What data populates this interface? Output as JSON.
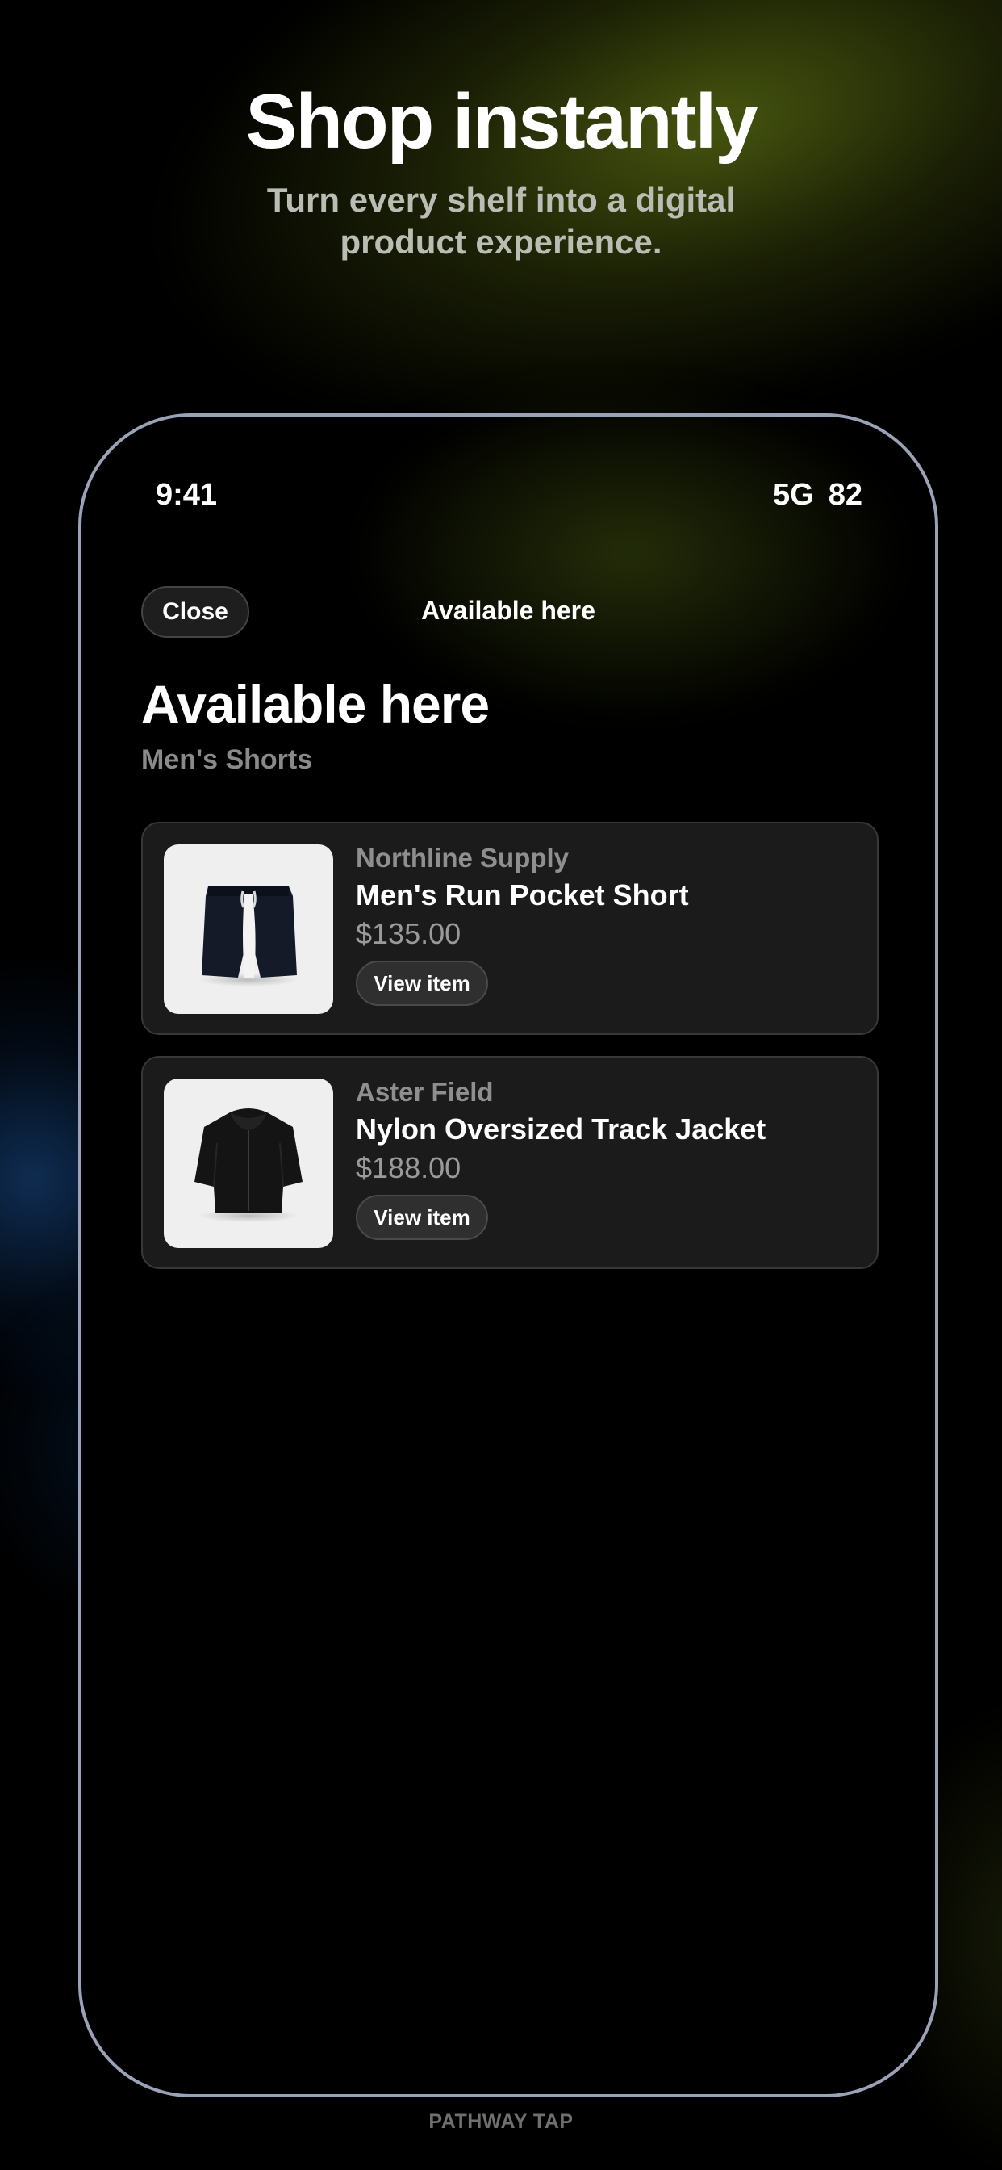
{
  "hero": {
    "title": "Shop instantly",
    "subtitle": "Turn every shelf into a digital product experience."
  },
  "status_bar": {
    "time": "9:41",
    "network": "5G",
    "battery": "82"
  },
  "nav": {
    "close_label": "Close",
    "title": "Available here"
  },
  "page": {
    "title": "Available here",
    "category": "Men's Shorts"
  },
  "products": [
    {
      "brand": "Northline Supply",
      "name": "Men's Run Pocket Short",
      "price": "$135.00",
      "button_label": "View item",
      "image_icon": "shorts-icon"
    },
    {
      "brand": "Aster Field",
      "name": "Nylon Oversized Track Jacket",
      "price": "$188.00",
      "button_label": "View item",
      "image_icon": "jacket-icon"
    }
  ],
  "footer": {
    "label": "PATHWAY TAP"
  },
  "colors": {
    "background": "#000000",
    "card": "#1b1b1b",
    "frame": "#9aa2b8",
    "muted_text": "#8f8f8f"
  }
}
